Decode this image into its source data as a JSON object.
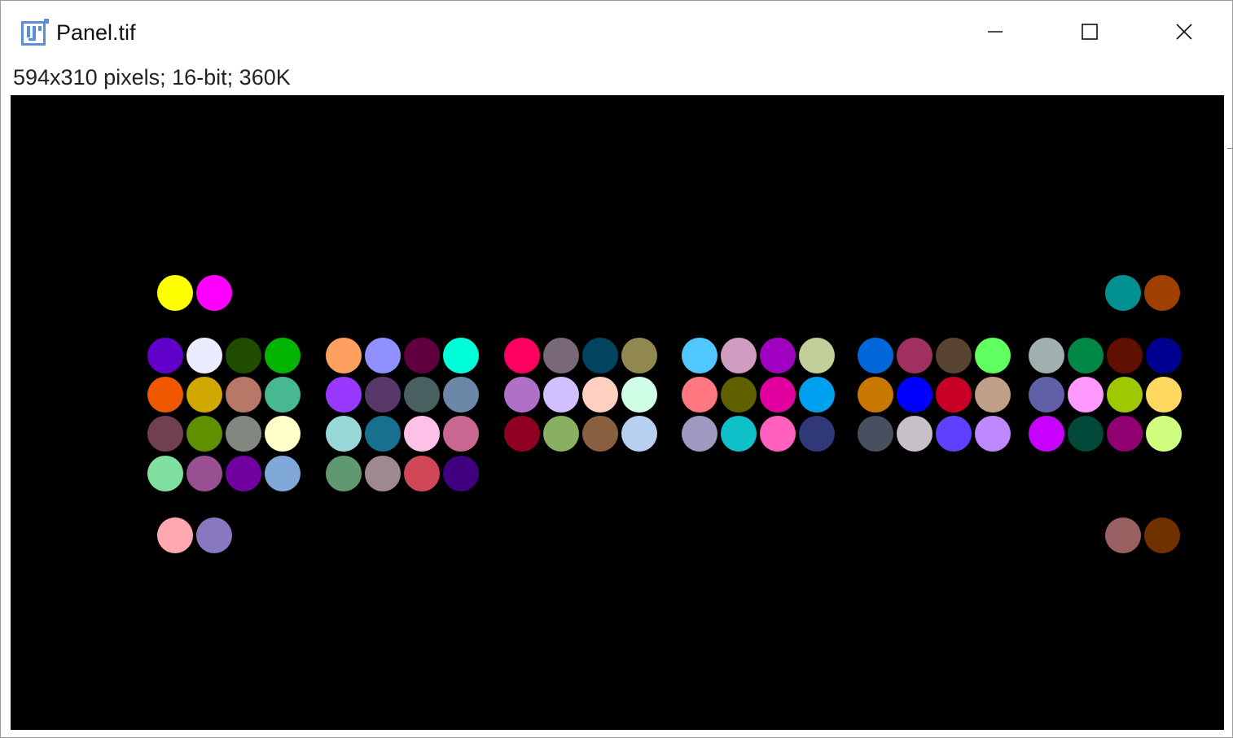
{
  "window": {
    "title": "Panel.tif",
    "info": "594x310 pixels; 16-bit; 360K",
    "controls": {
      "minimize": "minimize-icon",
      "maximize": "maximize-icon",
      "close": "close-icon"
    },
    "app_icon": "imagej-icon"
  },
  "image": {
    "background": "#000000",
    "rows": [
      {
        "segments": [
          [
            "#FFFF00",
            "#FF00FF"
          ],
          [],
          [],
          [],
          [],
          [
            "#009090",
            "#A04000"
          ]
        ]
      },
      {
        "segments": [
          [
            "#6000C8",
            "#ECECFF",
            "#204C00",
            "#00B400"
          ],
          [
            "#FFA060",
            "#9090FF",
            "#600040",
            "#00FFD8"
          ],
          [
            "#FF0060",
            "#786878",
            "#004460",
            "#908850"
          ],
          [
            "#50C8FF",
            "#D09CC0",
            "#A000C0",
            "#C0D098"
          ],
          [
            "#0068D8",
            "#A03060",
            "#584430",
            "#60FF60"
          ],
          [
            "#A0B0B0",
            "#008848",
            "#601000",
            "#000090"
          ]
        ]
      },
      {
        "segments": [
          [
            "#F05800",
            "#D0A800",
            "#B87868",
            "#48B890"
          ],
          [
            "#9838FF",
            "#583868",
            "#486060",
            "#6C88A8"
          ],
          [
            "#B070C8",
            "#D0C0FF",
            "#FFD0C0",
            "#D0FFE8"
          ],
          [
            "#FF7880",
            "#606000",
            "#E000A0",
            "#00A0F0"
          ],
          [
            "#C87800",
            "#0000FF",
            "#C80028",
            "#C0A088"
          ],
          [
            "#6060A8",
            "#FF98FF",
            "#A0C800",
            "#FFD860"
          ]
        ]
      },
      {
        "segments": [
          [
            "#704050",
            "#609000",
            "#808880",
            "#FFFFC8"
          ],
          [
            "#98D8D8",
            "#187090",
            "#FFC0E8",
            "#C86890"
          ],
          [
            "#900020",
            "#88B060",
            "#886040",
            "#B8D0F0"
          ],
          [
            "#A098C0",
            "#10C0C8",
            "#FF60C0",
            "#303878"
          ],
          [
            "#485060",
            "#C8C0C8",
            "#6040FF",
            "#C088FF"
          ],
          [
            "#C800FF",
            "#004838",
            "#900070",
            "#D0FF80"
          ]
        ]
      },
      {
        "segments": [
          [
            "#80E0A0",
            "#985090",
            "#7000A0",
            "#80A8D8"
          ],
          [
            "#609870",
            "#A08890",
            "#D04858",
            "#400080"
          ],
          [],
          [],
          [],
          []
        ]
      },
      {
        "segments": [
          [
            "#FFA8B0",
            "#8878C0"
          ],
          [],
          [],
          [],
          [],
          [
            "#986060",
            "#703000"
          ]
        ]
      }
    ]
  }
}
